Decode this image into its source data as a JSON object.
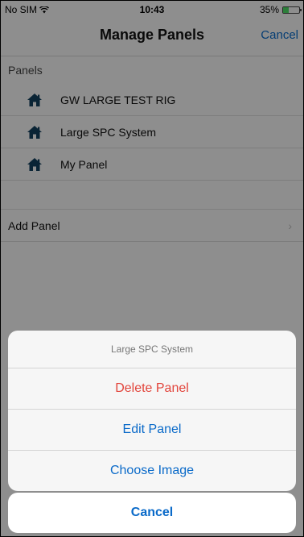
{
  "status_bar": {
    "carrier": "No SIM",
    "time": "10:43",
    "battery": "35%",
    "battery_level": 0.35
  },
  "nav": {
    "title": "Manage Panels",
    "cancel_label": "Cancel"
  },
  "panels_section": {
    "header": "Panels",
    "items": [
      {
        "label": "GW LARGE TEST RIG",
        "icon": "house-icon"
      },
      {
        "label": "Large SPC System",
        "icon": "house-icon"
      },
      {
        "label": "My Panel",
        "icon": "house-icon"
      }
    ]
  },
  "add_panel": {
    "label": "Add Panel",
    "chevron": "›"
  },
  "action_sheet": {
    "title": "Large SPC System",
    "delete_label": "Delete Panel",
    "edit_label": "Edit Panel",
    "choose_image_label": "Choose Image",
    "cancel_label": "Cancel"
  },
  "colors": {
    "accent": "#0a6ac9",
    "destructive": "#e2453c",
    "icon": "#123e5c"
  }
}
